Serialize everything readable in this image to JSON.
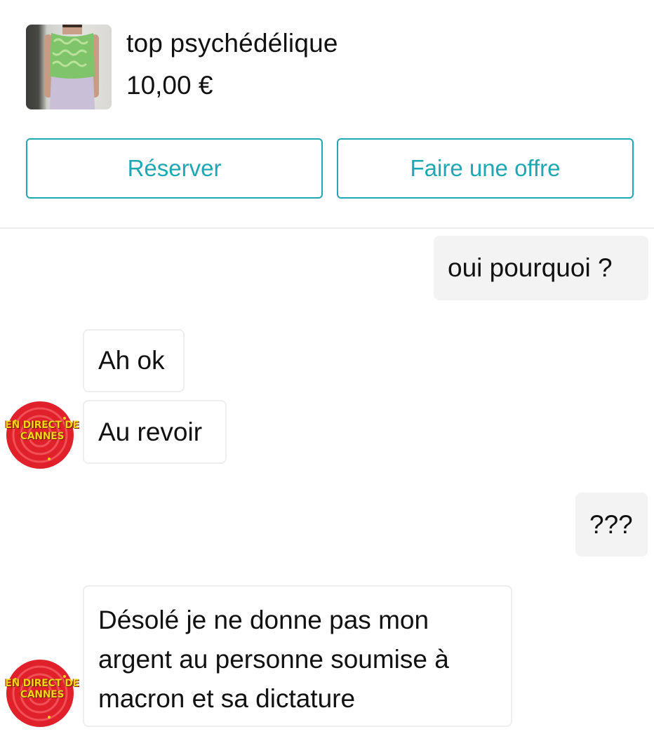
{
  "product": {
    "title": "top psychédélique",
    "price": "10,00 €",
    "thumbnail_icon": "product-photo"
  },
  "actions": {
    "reserve_label": "Réserver",
    "offer_label": "Faire une offre"
  },
  "colors": {
    "accent": "#21a9b3",
    "outgoing_bubble": "#f3f3f3",
    "incoming_border": "#eeeeee",
    "avatar_red": "#e0202a",
    "avatar_text": "#f4d21a"
  },
  "seller_avatar": {
    "line1": "EN DIRECT DE",
    "line2": "CANNES"
  },
  "messages": [
    {
      "side": "outgoing",
      "text": "oui pourquoi ?"
    },
    {
      "side": "incoming",
      "text": "Ah ok"
    },
    {
      "side": "incoming",
      "text": "Au revoir"
    },
    {
      "side": "outgoing",
      "text": "???"
    },
    {
      "side": "incoming",
      "lines": [
        "Désolé je ne donne pas mon",
        "argent au personne soumise à",
        "macron et sa dictature"
      ]
    }
  ]
}
